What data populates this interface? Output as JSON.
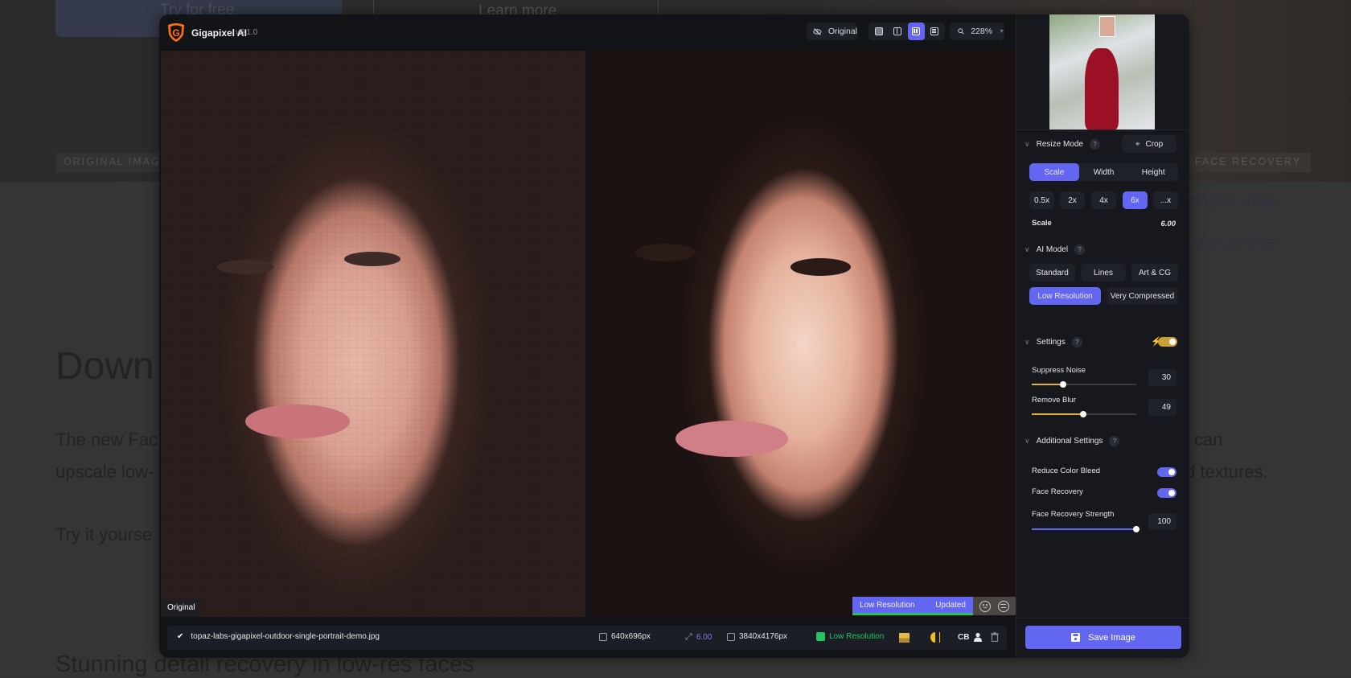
{
  "background_page": {
    "try_button": "Try for free",
    "learn_button": "Learn more",
    "label_original": "ORIGINAL IMAGE",
    "label_face": "FACE RECOVERY",
    "heading_partial": "Down",
    "para_line1_partial": "The new Fac",
    "para_line1_end": "can",
    "para_line2_partial": "upscale low-",
    "para_line2_end": "d textures.",
    "try_line_partial": "Try it yourse",
    "link_original": "Original Image",
    "link_settings": "View Settings",
    "subheading_partial": "Stunning detail recovery in low-res faces"
  },
  "app": {
    "name": "Gigapixel AI",
    "version": "v6.1.0",
    "toolbar": {
      "original_toggle_label": "Original",
      "view_modes": [
        "single-view",
        "split-view",
        "side-by-side",
        "comparison-grid"
      ],
      "active_view": "side-by-side",
      "zoom_level": "228%"
    },
    "preview": {
      "left_label": "Original",
      "status_model": "Low Resolution",
      "status_state": "Updated",
      "status_progress": 1.0
    },
    "bottom_bar": {
      "filename": "topaz-labs-gigapixel-outdoor-single-portrait-demo.jpg",
      "input_size": "640x696px",
      "scale": "6.00",
      "output_size": "3840x4176px",
      "model": "Low Resolution",
      "cb_label": "CB"
    },
    "sidebar": {
      "resize_mode": {
        "title": "Resize Mode",
        "crop_label": "Crop",
        "modes": [
          "Scale",
          "Width",
          "Height"
        ],
        "active_mode": "Scale",
        "scale_presets": [
          "0.5x",
          "2x",
          "4x",
          "6x",
          "...x"
        ],
        "active_preset": "6x",
        "scale_label": "Scale",
        "scale_value": "6.00"
      },
      "ai_model": {
        "title": "AI Model",
        "models_row1": [
          "Standard",
          "Lines",
          "Art & CG"
        ],
        "models_row2": [
          "Low Resolution",
          "Very Compressed"
        ],
        "active_model": "Low Resolution"
      },
      "settings": {
        "title": "Settings",
        "auto_enabled": true,
        "suppress_noise_label": "Suppress Noise",
        "suppress_noise_value": "30",
        "suppress_noise_fraction": 0.3,
        "remove_blur_label": "Remove Blur",
        "remove_blur_value": "49",
        "remove_blur_fraction": 0.49
      },
      "additional_settings": {
        "title": "Additional Settings",
        "reduce_color_bleed_label": "Reduce Color Bleed",
        "reduce_color_bleed_on": true,
        "face_recovery_label": "Face Recovery",
        "face_recovery_on": true,
        "face_strength_label": "Face Recovery Strength",
        "face_strength_value": "100",
        "face_strength_fraction": 1.0
      },
      "save_label": "Save Image"
    },
    "colors": {
      "accent": "#6366f1",
      "settings_accent": "#e0b23a",
      "success": "#22c55e",
      "logo": "#f97316"
    }
  }
}
